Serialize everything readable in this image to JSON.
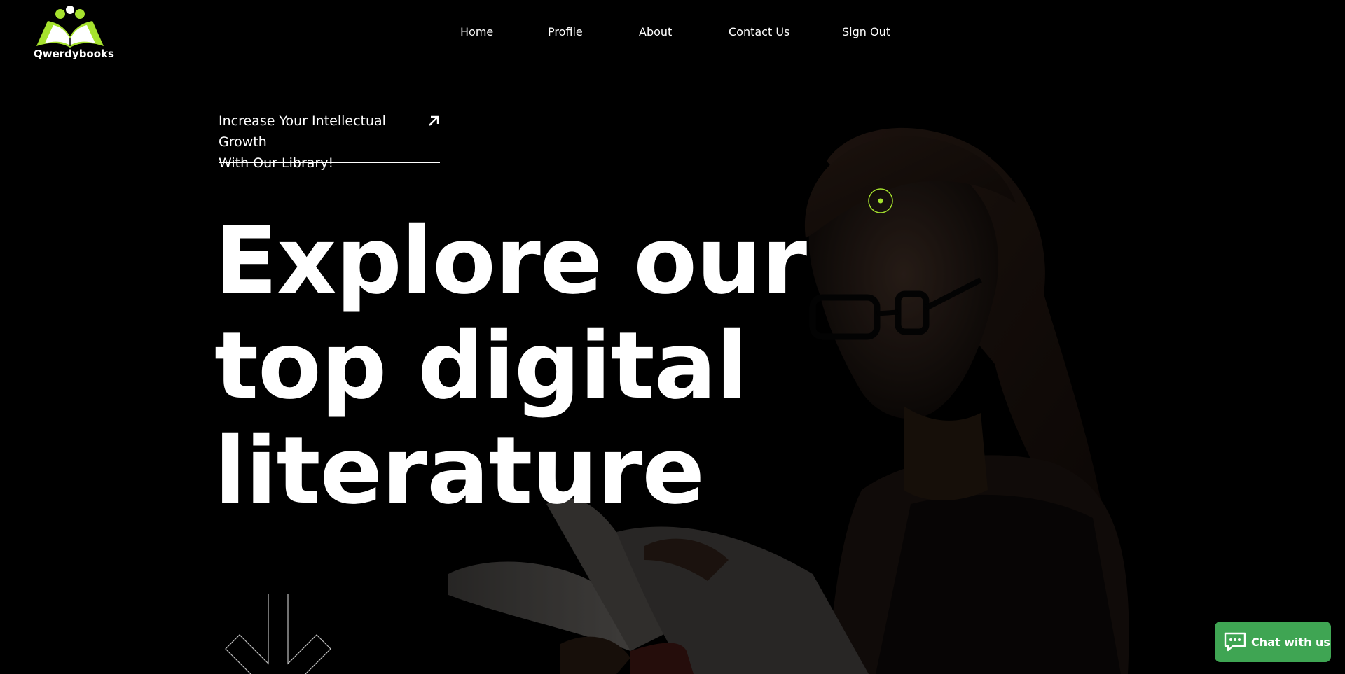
{
  "brand": {
    "name": "Qwerdybooks",
    "accent_color": "#a6e22e"
  },
  "nav": {
    "home": "Home",
    "profile": "Profile",
    "about": "About",
    "contact": "Contact Us",
    "signout": "Sign Out"
  },
  "hero": {
    "tagline_line1": "Increase Your Intellectual Growth",
    "tagline_line2": "With Our Library!",
    "tagline_icon": "arrow-up-right-icon",
    "headline_line1": "Explore our",
    "headline_line2": "top digital",
    "headline_line3": "literature",
    "scroll_icon": "arrow-down-icon"
  },
  "chat": {
    "label": "Chat with us",
    "icon": "chat-bubble-icon",
    "color": "#3fa553"
  }
}
